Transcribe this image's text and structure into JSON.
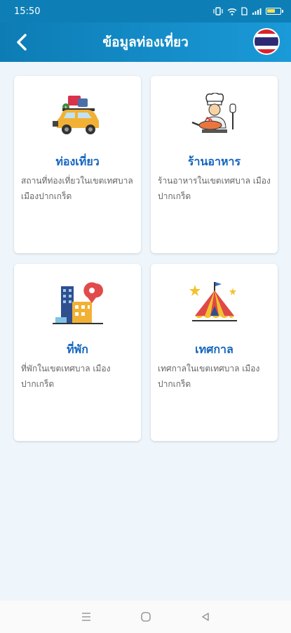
{
  "status_bar": {
    "time": "15:50",
    "icons": [
      "vibrate-icon",
      "wifi-icon",
      "sim-icon",
      "signal-icon",
      "battery-icon"
    ]
  },
  "app_bar": {
    "title": "ข้อมูลท่องเที่ยว",
    "back_icon": "chevron-left-icon",
    "language_flag": "thailand-flag-icon"
  },
  "cards": [
    {
      "title": "ท่องเที่ยว",
      "description": "สถานที่ท่องเที่ยวในเขตเทศบาล เมืองปากเกร็ด",
      "icon": "car-luggage-icon"
    },
    {
      "title": "ร้านอาหาร",
      "description": "ร้านอาหารในเขตเทศบาล เมืองปากเกร็ด",
      "icon": "chef-cooking-icon"
    },
    {
      "title": "ที่พัก",
      "description": "ที่พักในเขตเทศบาล เมืองปากเกร็ด",
      "icon": "hotel-pin-icon"
    },
    {
      "title": "เทศกาล",
      "description": "เทศกาลในเขตเทศบาล เมืองปากเกร็ด",
      "icon": "festival-tent-icon"
    }
  ],
  "nav_bar": {
    "icons": [
      "menu-icon",
      "home-icon",
      "back-icon"
    ]
  },
  "colors": {
    "primary": "#0e7fb6",
    "title_blue": "#1565c0",
    "background": "#eef5fb"
  }
}
